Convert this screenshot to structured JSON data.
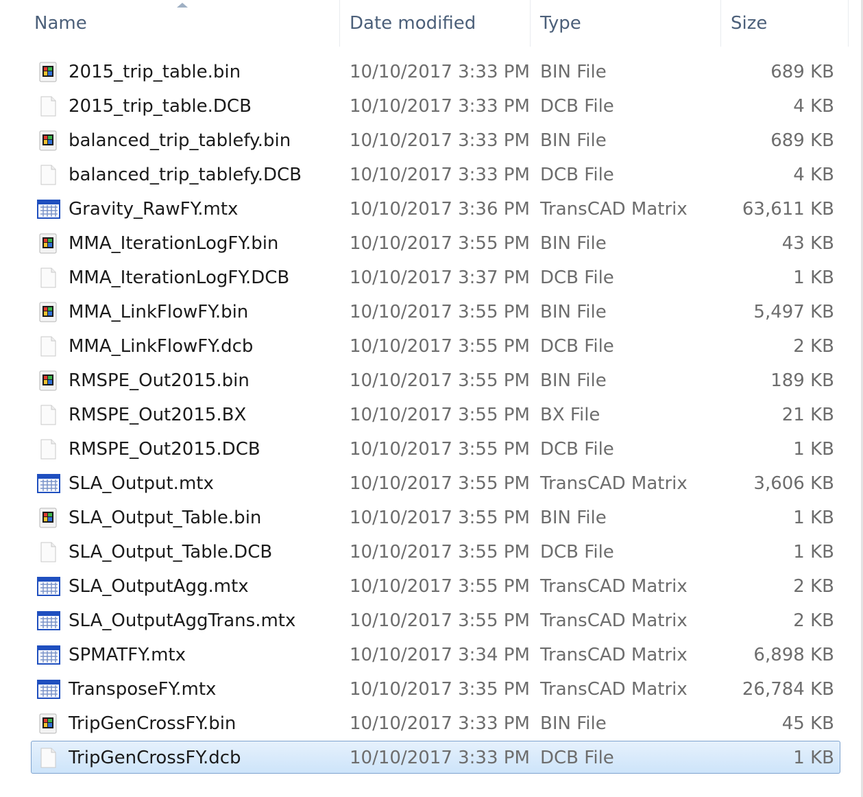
{
  "columns": {
    "name": "Name",
    "date_modified": "Date modified",
    "type": "Type",
    "size": "Size"
  },
  "colors": {
    "header_text": "#4c607a",
    "selection_fill": "#cde4fa",
    "selection_border": "#7da2ce"
  },
  "files": [
    {
      "name": "2015_trip_table.bin",
      "date": "10/10/2017 3:33 PM",
      "type": "BIN File",
      "size": "689 KB",
      "icon": "bin-file-icon"
    },
    {
      "name": "2015_trip_table.DCB",
      "date": "10/10/2017 3:33 PM",
      "type": "DCB File",
      "size": "4 KB",
      "icon": "blank-file-icon"
    },
    {
      "name": "balanced_trip_tablefy.bin",
      "date": "10/10/2017 3:33 PM",
      "type": "BIN File",
      "size": "689 KB",
      "icon": "bin-file-icon"
    },
    {
      "name": "balanced_trip_tablefy.DCB",
      "date": "10/10/2017 3:33 PM",
      "type": "DCB File",
      "size": "4 KB",
      "icon": "blank-file-icon"
    },
    {
      "name": "Gravity_RawFY.mtx",
      "date": "10/10/2017 3:36 PM",
      "type": "TransCAD Matrix",
      "size": "63,611 KB",
      "icon": "matrix-file-icon"
    },
    {
      "name": "MMA_IterationLogFY.bin",
      "date": "10/10/2017 3:55 PM",
      "type": "BIN File",
      "size": "43 KB",
      "icon": "bin-file-icon"
    },
    {
      "name": "MMA_IterationLogFY.DCB",
      "date": "10/10/2017 3:37 PM",
      "type": "DCB File",
      "size": "1 KB",
      "icon": "blank-file-icon"
    },
    {
      "name": "MMA_LinkFlowFY.bin",
      "date": "10/10/2017 3:55 PM",
      "type": "BIN File",
      "size": "5,497 KB",
      "icon": "bin-file-icon"
    },
    {
      "name": "MMA_LinkFlowFY.dcb",
      "date": "10/10/2017 3:55 PM",
      "type": "DCB File",
      "size": "2 KB",
      "icon": "blank-file-icon"
    },
    {
      "name": "RMSPE_Out2015.bin",
      "date": "10/10/2017 3:55 PM",
      "type": "BIN File",
      "size": "189 KB",
      "icon": "bin-file-icon"
    },
    {
      "name": "RMSPE_Out2015.BX",
      "date": "10/10/2017 3:55 PM",
      "type": "BX File",
      "size": "21 KB",
      "icon": "blank-file-icon"
    },
    {
      "name": "RMSPE_Out2015.DCB",
      "date": "10/10/2017 3:55 PM",
      "type": "DCB File",
      "size": "1 KB",
      "icon": "blank-file-icon"
    },
    {
      "name": "SLA_Output.mtx",
      "date": "10/10/2017 3:55 PM",
      "type": "TransCAD Matrix",
      "size": "3,606 KB",
      "icon": "matrix-file-icon"
    },
    {
      "name": "SLA_Output_Table.bin",
      "date": "10/10/2017 3:55 PM",
      "type": "BIN File",
      "size": "1 KB",
      "icon": "bin-file-icon"
    },
    {
      "name": "SLA_Output_Table.DCB",
      "date": "10/10/2017 3:55 PM",
      "type": "DCB File",
      "size": "1 KB",
      "icon": "blank-file-icon"
    },
    {
      "name": "SLA_OutputAgg.mtx",
      "date": "10/10/2017 3:55 PM",
      "type": "TransCAD Matrix",
      "size": "2 KB",
      "icon": "matrix-file-icon"
    },
    {
      "name": "SLA_OutputAggTrans.mtx",
      "date": "10/10/2017 3:55 PM",
      "type": "TransCAD Matrix",
      "size": "2 KB",
      "icon": "matrix-file-icon"
    },
    {
      "name": "SPMATFY.mtx",
      "date": "10/10/2017 3:34 PM",
      "type": "TransCAD Matrix",
      "size": "6,898 KB",
      "icon": "matrix-file-icon"
    },
    {
      "name": "TransposeFY.mtx",
      "date": "10/10/2017 3:35 PM",
      "type": "TransCAD Matrix",
      "size": "26,784 KB",
      "icon": "matrix-file-icon"
    },
    {
      "name": "TripGenCrossFY.bin",
      "date": "10/10/2017 3:33 PM",
      "type": "BIN File",
      "size": "45 KB",
      "icon": "bin-file-icon"
    },
    {
      "name": "TripGenCrossFY.dcb",
      "date": "10/10/2017 3:33 PM",
      "type": "DCB File",
      "size": "1 KB",
      "icon": "blank-file-icon",
      "selected": true
    }
  ]
}
